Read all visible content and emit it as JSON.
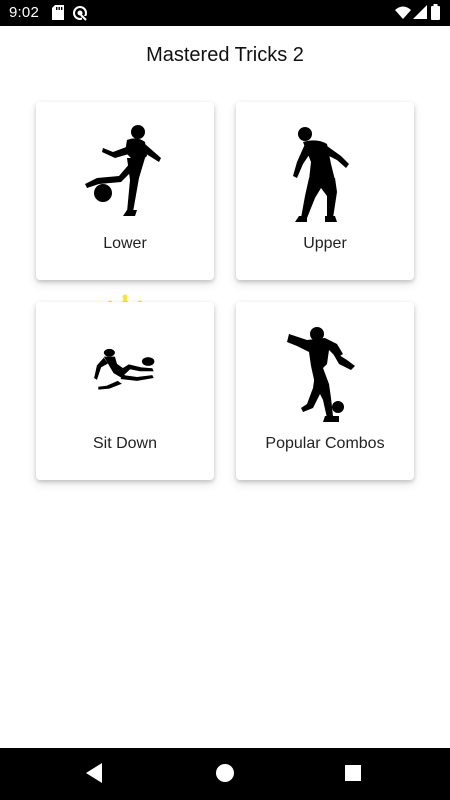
{
  "status_bar": {
    "time": "9:02",
    "icons": [
      "sd-card-icon",
      "sync-icon",
      "wifi-icon",
      "signal-icon",
      "battery-icon"
    ]
  },
  "screen": {
    "title": "Mastered Tricks 2"
  },
  "categories": [
    {
      "label": "Lower",
      "icon": "lower-trick-figure-icon"
    },
    {
      "label": "Upper",
      "icon": "upper-trick-figure-icon"
    },
    {
      "label": "Sit Down",
      "icon": "sit-down-trick-figure-icon",
      "badge": "crown-icon"
    },
    {
      "label": "Popular Combos",
      "icon": "combo-trick-figure-icon"
    }
  ],
  "colors": {
    "crown": "#F7E43A",
    "silhouette": "#000000",
    "card_background": "#FFFFFF",
    "title_text": "#111111"
  },
  "nav_bar": {
    "buttons": [
      "back-icon",
      "home-icon",
      "recents-icon"
    ]
  }
}
